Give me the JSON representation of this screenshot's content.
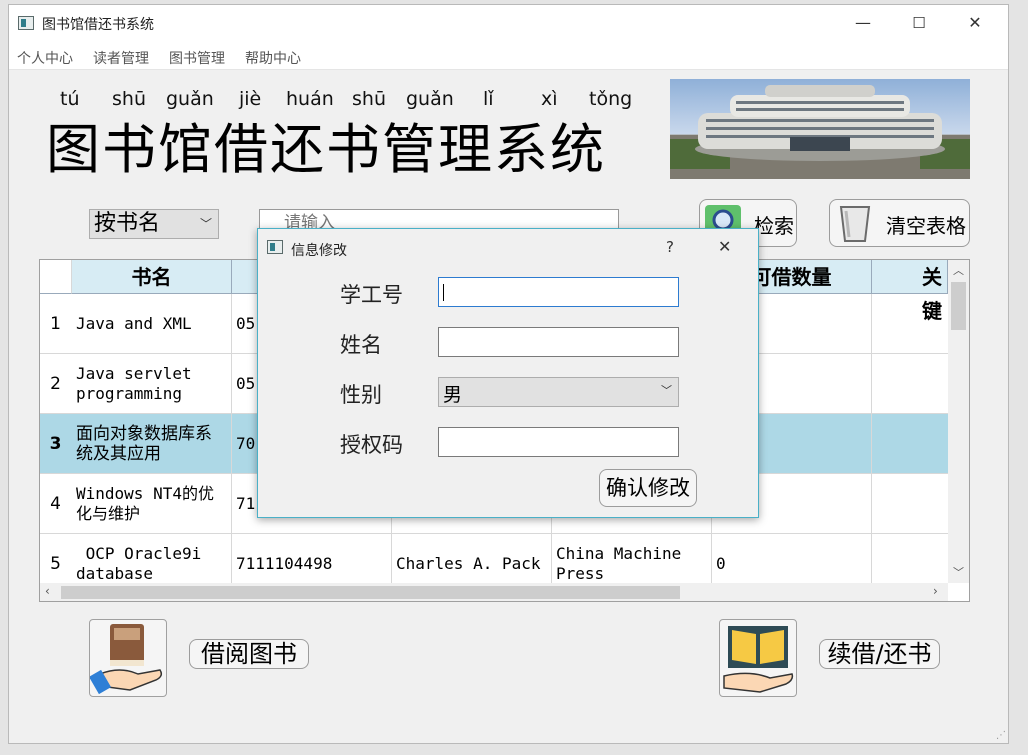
{
  "window": {
    "title": "图书馆借还书系统",
    "minimize": "—",
    "maximize": "☐",
    "close": "✕"
  },
  "menu": [
    "个人中心",
    "读者管理",
    "图书管理",
    "帮助中心"
  ],
  "header": {
    "pinyin": [
      "tú",
      "shū",
      "guǎn",
      "jiè",
      "huán",
      "shū",
      "guǎn",
      "lǐ",
      "xì",
      "tǒng"
    ],
    "title": "图书馆借还书管理系统"
  },
  "search": {
    "mode_selected": "按书名",
    "placeholder": "请输入",
    "search_label": "检索",
    "clear_label": "清空表格"
  },
  "table": {
    "columns": [
      "书名",
      "",
      "",
      "",
      "可借数量",
      "关键"
    ],
    "rows": [
      {
        "num": "1",
        "cells": [
          "Java and XML",
          "05",
          "",
          "",
          ""
        ]
      },
      {
        "num": "2",
        "cells": [
          "Java servlet programming",
          "05",
          "",
          "",
          ""
        ]
      },
      {
        "num": "3",
        "cells": [
          "面向对象数据库系统及其应用",
          "70",
          "",
          "",
          ""
        ]
      },
      {
        "num": "4",
        "cells": [
          "Windows NT4的优化与维护",
          "71",
          "",
          "",
          ""
        ]
      },
      {
        "num": "5",
        "cells": [
          " OCP Oracle9i database",
          "7111104498",
          "Charles A. Pack",
          "China Machine Press",
          "0"
        ]
      }
    ]
  },
  "dialog": {
    "title": "信息修改",
    "help": "?",
    "close": "✕",
    "fields": {
      "student_id_label": "学工号",
      "student_id_value": "",
      "name_label": "姓名",
      "name_value": "",
      "gender_label": "性别",
      "gender_value": "男",
      "auth_label": "授权码",
      "auth_value": ""
    },
    "confirm_label": "确认修改"
  },
  "bottom": {
    "borrow_label": "借阅图书",
    "renew_label": "续借/还书"
  },
  "colors": {
    "selected_row": "#add8e6",
    "header_bg": "#d7ecf4",
    "dialog_border": "#4ab0c7"
  }
}
